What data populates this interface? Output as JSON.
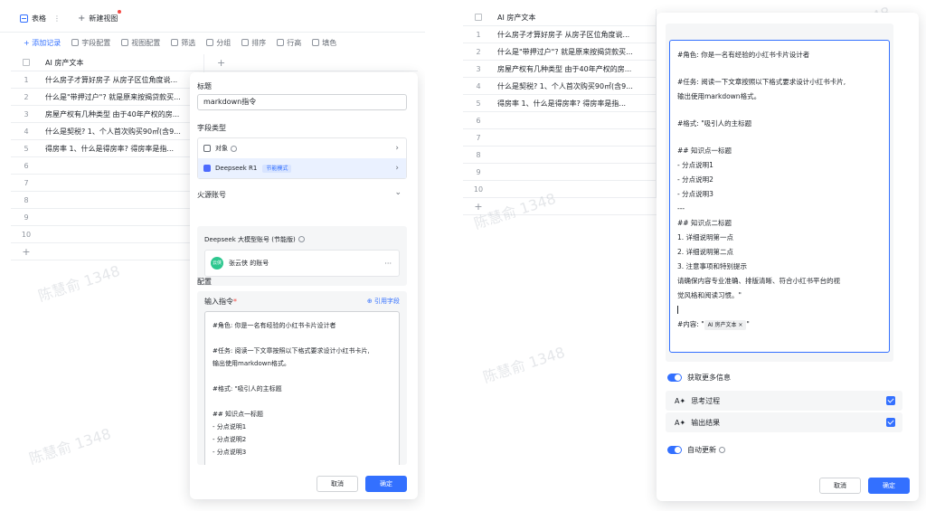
{
  "tabs": {
    "active_label": "表格",
    "new_label": "新建视图"
  },
  "toolbar": {
    "add_record": "+ 添加记录",
    "field_config": "字段配置",
    "view_config": "视图配置",
    "filter": "筛选",
    "group": "分组",
    "sort": "排序",
    "row_height": "行高",
    "fill_color": "填色"
  },
  "grid": {
    "column_header": "AI 房产文本",
    "rows": [
      {
        "num": "1",
        "text": "什么房子才算好房子 从房子区位角度说..."
      },
      {
        "num": "2",
        "text": "什么是\"带押过户\"? 就是原来按揭贷款买..."
      },
      {
        "num": "3",
        "text": "房屋产权有几种类型 由于40年产权的房..."
      },
      {
        "num": "4",
        "text": "什么是契税? 1、个人首次购买90㎡(含9..."
      },
      {
        "num": "5",
        "text": "得房率 1、什么是得房率? 得房率是指..."
      },
      {
        "num": "6",
        "text": ""
      },
      {
        "num": "7",
        "text": ""
      },
      {
        "num": "8",
        "text": ""
      },
      {
        "num": "9",
        "text": ""
      },
      {
        "num": "10",
        "text": ""
      }
    ]
  },
  "left_dialog": {
    "title_label": "标题",
    "title_value": "markdown指令",
    "field_type_label": "字段类型",
    "type_object": "对象",
    "type_deepseek": "Deepseek R1",
    "type_badge": "节能模式",
    "account_label": "火源账号",
    "account_title": "Deepseek 大模型账号 (节能版)",
    "account_avatar": "云侠",
    "account_name": "张云侠 的账号",
    "config_label": "配置",
    "input_label": "输入指令",
    "input_required": "*",
    "reference_link": "⊕ 引用字段",
    "prompt_lines": [
      "#角色: 你是一名有经验的小红书卡片设计者",
      "",
      "#任务: 阅读一下文章按照以下格式要求设计小红书卡片,",
      "输出使用markdown格式。",
      "",
      "#格式: \"吸引人的主标题",
      "",
      "## 知识点一标题",
      "- 分点说明1",
      "- 分点说明2",
      "- 分点说明3"
    ],
    "cancel": "取消",
    "ok": "确定"
  },
  "right_dialog": {
    "prompt_lines": [
      "#角色: 你是一名有经验的小红书卡片设计者",
      "",
      "#任务: 阅读一下文章按照以下格式要求设计小红书卡片,",
      "输出使用markdown格式。",
      "",
      "#格式: \"吸引人的主标题",
      "",
      "## 知识点一标题",
      "- 分点说明1",
      "- 分点说明2",
      "- 分点说明3",
      "---",
      "## 知识点二标题",
      "1. 详细说明第一点",
      "2. 详细说明第二点",
      "3. 注意事项和特别提示",
      "请确保内容专业准确、排版清晰、符合小红书平台的视",
      "觉风格和阅读习惯。\""
    ],
    "content_prefix": "#内容: \"",
    "content_chip": "AI 房产文本 ×",
    "content_suffix": "\"",
    "get_more_info": "获取更多信息",
    "thinking_process": "思考过程",
    "output_result": "输出结果",
    "auto_update": "自动更新",
    "cancel": "取消",
    "ok": "确定"
  },
  "watermark": "陈慧俞 1348",
  "colors": {
    "accent": "#3370ff",
    "border": "#d0d3d6",
    "muted": "#8f959e"
  }
}
